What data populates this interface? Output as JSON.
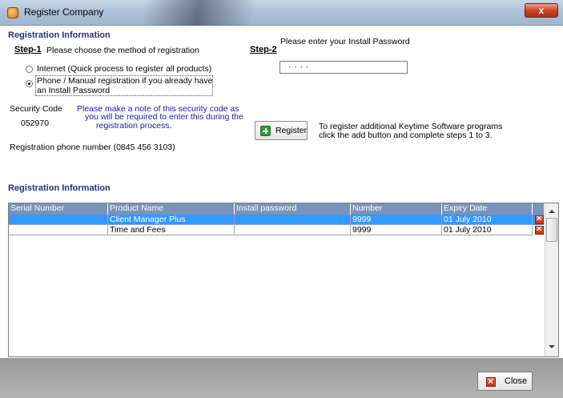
{
  "window": {
    "title": "Register Company",
    "close_glyph": "x"
  },
  "registration": {
    "section_title": "Registration Information",
    "step1_label": "Step-1",
    "step1_text": "Please choose the method of registration",
    "option_internet": "Internet (Quick process to register all products)",
    "option_phone_line1": "Phone / Manual registration if you already have",
    "option_phone_line2": "an Install Password",
    "selected_option": "phone",
    "security_code_label": "Security Code",
    "security_code_value": "052970",
    "security_note_line1": "Please make a note of this security code as",
    "security_note_line2": "you will be required to enter this during the",
    "security_note_line3": "registration process.",
    "phone_number_text": "Registration phone number (0845 456 3103)",
    "step2_label": "Step-2",
    "step2_text": "Please enter your Install Password",
    "password_value": "····",
    "register_button": "Register",
    "additional_line1": "To register additional Keytime Software programs",
    "additional_line2": "click the add button and complete steps 1 to 3."
  },
  "grid": {
    "section_title": "Registration Information",
    "columns": [
      "Serial Number",
      "Product Name",
      "Install password",
      "Number",
      "Expiry Date"
    ],
    "rows": [
      {
        "serial": "",
        "product": "Client Manager Plus",
        "password": "",
        "number": "9999",
        "expiry": "01 July 2010",
        "selected": true
      },
      {
        "serial": "",
        "product": "Time and Fees",
        "password": "",
        "number": "9999",
        "expiry": "01 July 2010",
        "selected": false
      }
    ]
  },
  "footer": {
    "close_button": "Close"
  },
  "icons": {
    "app": "app-icon",
    "register": "plus-icon",
    "delete": "delete-icon",
    "close": "close-icon"
  },
  "colors": {
    "section_title": "#22337a",
    "note_text": "#2020a0",
    "grid_header": "#7a93b8",
    "selection": "#3399ff"
  }
}
